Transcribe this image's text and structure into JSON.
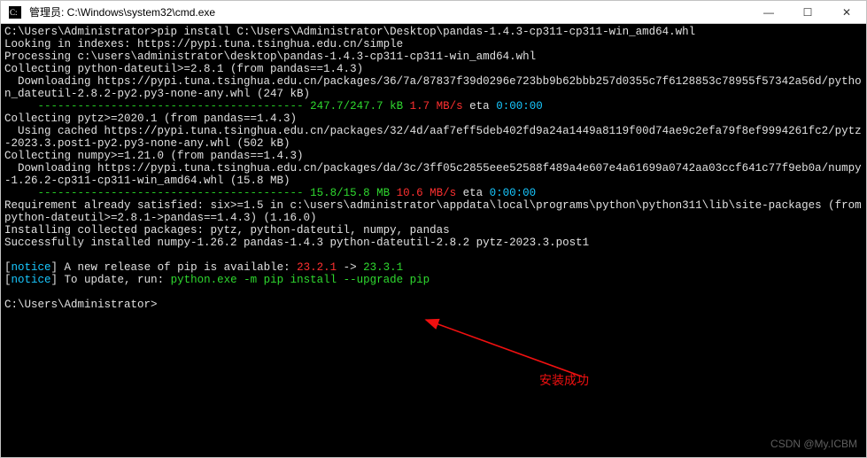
{
  "window": {
    "title": "管理员: C:\\Windows\\system32\\cmd.exe",
    "icon_name": "cmd-icon",
    "buttons": {
      "minimize": "—",
      "maximize": "☐",
      "close": "✕"
    }
  },
  "terminal": {
    "prompt1": "C:\\Users\\Administrator>",
    "cmd1": "pip install C:\\Users\\Administrator\\Desktop\\pandas-1.4.3-cp311-cp311-win_amd64.whl",
    "l2": "Looking in indexes: https://pypi.tuna.tsinghua.edu.cn/simple",
    "l3": "Processing c:\\users\\administrator\\desktop\\pandas-1.4.3-cp311-cp311-win_amd64.whl",
    "l4": "Collecting python-dateutil>=2.8.1 (from pandas==1.4.3)",
    "l5": "  Downloading https://pypi.tuna.tsinghua.edu.cn/packages/36/7a/87837f39d0296e723bb9b62bbb257d0355c7f6128853c78955f57342a56d/python_dateutil-2.8.2-py2.py3-none-any.whl (247 kB)",
    "dash1": "     ---------------------------------------- ",
    "p1_size": "247.7/247.7 kB",
    "p1_speed": "1.7 MB/s",
    "p1_eta_lbl": "eta",
    "p1_eta": "0:00:00",
    "l7": "Collecting pytz>=2020.1 (from pandas==1.4.3)",
    "l8": "  Using cached https://pypi.tuna.tsinghua.edu.cn/packages/32/4d/aaf7eff5deb402fd9a24a1449a8119f00d74ae9c2efa79f8ef9994261fc2/pytz-2023.3.post1-py2.py3-none-any.whl (502 kB)",
    "l9": "Collecting numpy>=1.21.0 (from pandas==1.4.3)",
    "l10": "  Downloading https://pypi.tuna.tsinghua.edu.cn/packages/da/3c/3ff05c2855eee52588f489a4e607e4a61699a0742aa03ccf641c77f9eb0a/numpy-1.26.2-cp311-cp311-win_amd64.whl (15.8 MB)",
    "dash2": "     ---------------------------------------- ",
    "p2_size": "15.8/15.8 MB",
    "p2_speed": "10.6 MB/s",
    "p2_eta_lbl": "eta",
    "p2_eta": "0:00:00",
    "l12": "Requirement already satisfied: six>=1.5 in c:\\users\\administrator\\appdata\\local\\programs\\python\\python311\\lib\\site-packages (from python-dateutil>=2.8.1->pandas==1.4.3) (1.16.0)",
    "l13": "Installing collected packages: pytz, python-dateutil, numpy, pandas",
    "l14": "Successfully installed numpy-1.26.2 pandas-1.4.3 python-dateutil-2.8.2 pytz-2023.3.post1",
    "notice_open": "[",
    "notice_tag": "notice",
    "notice_close": "]",
    "n1_txt": " A new release of pip is available: ",
    "n1_old": "23.2.1",
    "n1_arrow": " -> ",
    "n1_new": "23.3.1",
    "n2_txt": " To update, run: ",
    "n2_cmd": "python.exe -m pip install --upgrade pip",
    "prompt2": "C:\\Users\\Administrator>"
  },
  "annotation": {
    "label": "安装成功"
  },
  "watermark": "CSDN @My.ICBM"
}
